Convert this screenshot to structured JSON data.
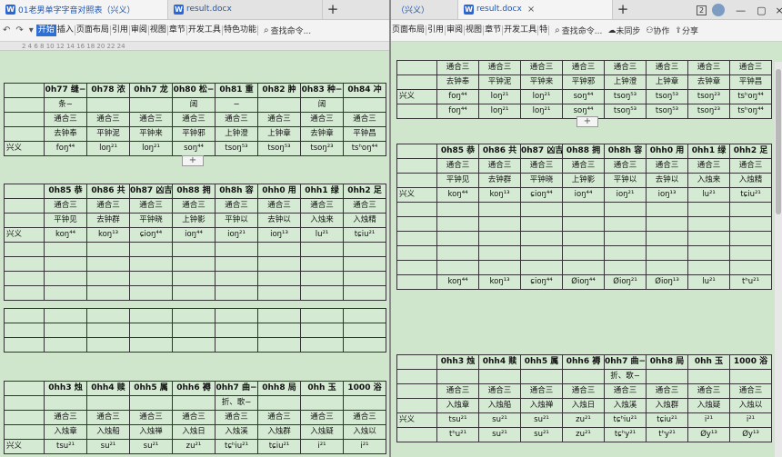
{
  "left": {
    "tabs": [
      {
        "label": "01老男单字字音对照表（兴义）",
        "active": true
      },
      {
        "label": "result.docx",
        "active": false
      }
    ],
    "menu": [
      "开始",
      "插入",
      "页面布局",
      "引用",
      "审阅",
      "视图",
      "章节",
      "开发工具",
      "特色功能"
    ],
    "search": "查找命令..."
  },
  "right": {
    "tabs": [
      {
        "label": "（兴义）",
        "active": false
      },
      {
        "label": "result.docx",
        "active": true
      }
    ],
    "menu": [
      "页面布局",
      "引用",
      "审阅",
      "视图",
      "章节",
      "开发工具",
      "特"
    ],
    "search": "查找命令...",
    "sync": "未同步",
    "collab": "协作",
    "share": "分享",
    "badge": "2"
  },
  "ruler": "2  4  6  8  10  12  14  16  18  20  22  24",
  "table1": {
    "heads": [
      "0h77 缝−",
      "0h78 浓",
      "0hh7 龙",
      "0h80 松−",
      "0h81 重",
      "0h82 肿",
      "0h83 种−",
      "0h84 冲"
    ],
    "sub": [
      "条−",
      "",
      "",
      "阔",
      "−",
      "",
      "阔",
      ""
    ],
    "r1": [
      "通合三",
      "通合三",
      "通合三",
      "通合三",
      "通合三",
      "通合三",
      "通合三",
      "通合三"
    ],
    "r2": [
      "去钟奉",
      "平钟泥",
      "平钟来",
      "平钟邪",
      "上钟澄",
      "上钟章",
      "去钟章",
      "平钟昌"
    ],
    "label": "兴义",
    "r3": [
      "foŋ⁴⁴",
      "loŋ²¹",
      "loŋ²¹",
      "soŋ⁴⁴",
      "tsoŋ⁵³",
      "tsoŋ⁵³",
      "tsoŋ²³",
      "tsʰoŋ⁴⁴"
    ]
  },
  "table2": {
    "heads": [
      "0h85 恭",
      "0h86 共",
      "0h87 凶吉",
      "0h88 拥",
      "0h8h 容",
      "0hh0 用",
      "0hh1 绿",
      "0hh2 足"
    ],
    "r1": [
      "通合三",
      "通合三",
      "通合三",
      "通合三",
      "通合三",
      "通合三",
      "通合三",
      "通合三"
    ],
    "r2": [
      "平钟见",
      "去钟群",
      "平钟晓",
      "上钟影",
      "平钟以",
      "去钟以",
      "入烛来",
      "入烛精"
    ],
    "label": "兴义",
    "r3": [
      "koŋ⁴⁴",
      "koŋ¹³",
      "ɕioŋ⁴⁴",
      "ioŋ⁴⁴",
      "ioŋ²¹",
      "ioŋ¹³",
      "lu²¹",
      "tɕiu²¹"
    ],
    "r4": [
      "koŋ⁴⁴",
      "koŋ¹³",
      "ɕioŋ⁴⁴",
      "Øioŋ⁴⁴",
      "Øioŋ²¹",
      "Øioŋ¹³",
      "lu²¹",
      "tʰu²¹"
    ]
  },
  "table3": {
    "heads": [
      "0hh3 烛",
      "0hh4 赎",
      "0hh5 属",
      "0hh6 褥",
      "0hh7 曲−",
      "0hh8 局",
      "0hh 玉",
      "1000 浴"
    ],
    "sub": [
      "",
      "",
      "",
      "",
      "折、歌−",
      "",
      "",
      ""
    ],
    "r1": [
      "通合三",
      "通合三",
      "通合三",
      "通合三",
      "通合三",
      "通合三",
      "通合三",
      "通合三"
    ],
    "r2": [
      "入烛章",
      "入烛船",
      "入烛禅",
      "入烛日",
      "入烛溪",
      "入烛群",
      "入烛疑",
      "入烛以"
    ],
    "label": "兴义",
    "r3": [
      "tsu²¹",
      "su²¹",
      "su²¹",
      "zu²¹",
      "tɕʰiu²¹",
      "tɕiu²¹",
      "i²¹",
      "i²¹"
    ],
    "r4": [
      "tʰu²¹",
      "su²¹",
      "su²¹",
      "zu²¹",
      "tɕʰy²¹",
      "tʰy²¹",
      "Øy¹³",
      "Øy¹³"
    ]
  },
  "colors": {
    "bg": "#d5ead3",
    "accent": "#2f6fd4",
    "tabText": "#1b56b8"
  }
}
